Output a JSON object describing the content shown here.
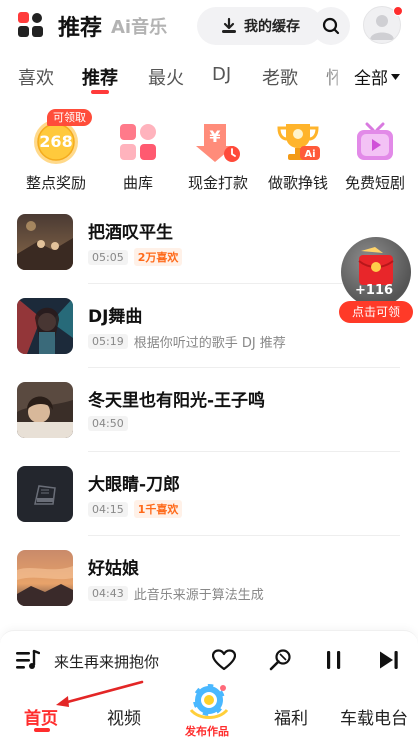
{
  "header": {
    "title": "推荐",
    "subtitle": "Ai音乐",
    "cache_label": "我的缓存"
  },
  "tabs": [
    {
      "label": "喜欢"
    },
    {
      "label": "推荐"
    },
    {
      "label": "最火"
    },
    {
      "label": "DJ"
    },
    {
      "label": "老歌"
    },
    {
      "label": "怀"
    }
  ],
  "all_tab_label": "全部",
  "quick_access": {
    "claim_badge": "可领取",
    "points": "268",
    "items": [
      {
        "label": "整点奖励",
        "icon": "coin-icon"
      },
      {
        "label": "曲库",
        "icon": "library-grid-icon"
      },
      {
        "label": "现金打款",
        "icon": "cash-transfer-icon"
      },
      {
        "label": "做歌挣钱",
        "icon": "ai-trophy-icon"
      },
      {
        "label": "免费短剧",
        "icon": "video-play-icon"
      }
    ]
  },
  "songs": [
    {
      "title": "把酒叹平生",
      "duration": "05:05",
      "likes": "2万喜欢",
      "desc": ""
    },
    {
      "title": "DJ舞曲",
      "duration": "05:19",
      "likes": "",
      "desc": "根据你听过的歌手 DJ 推荐"
    },
    {
      "title": "冬天里也有阳光-王子鸣",
      "duration": "04:50",
      "likes": "",
      "desc": ""
    },
    {
      "title": "大眼睛-刀郎",
      "duration": "04:15",
      "likes": "1千喜欢",
      "desc": ""
    },
    {
      "title": "好姑娘",
      "duration": "04:43",
      "likes": "",
      "desc": "此音乐来源于算法生成"
    }
  ],
  "reward_float": {
    "amount": "+116",
    "button_label": "点击可领"
  },
  "player": {
    "now_playing": "来生再来拥抱你"
  },
  "bottom_nav": {
    "home": "首页",
    "video": "视频",
    "publish": "发布作品",
    "welfare": "福利",
    "car": "车载电台"
  },
  "colors": {
    "accent": "#ff2d2d",
    "orange": "#ff6a1a"
  }
}
